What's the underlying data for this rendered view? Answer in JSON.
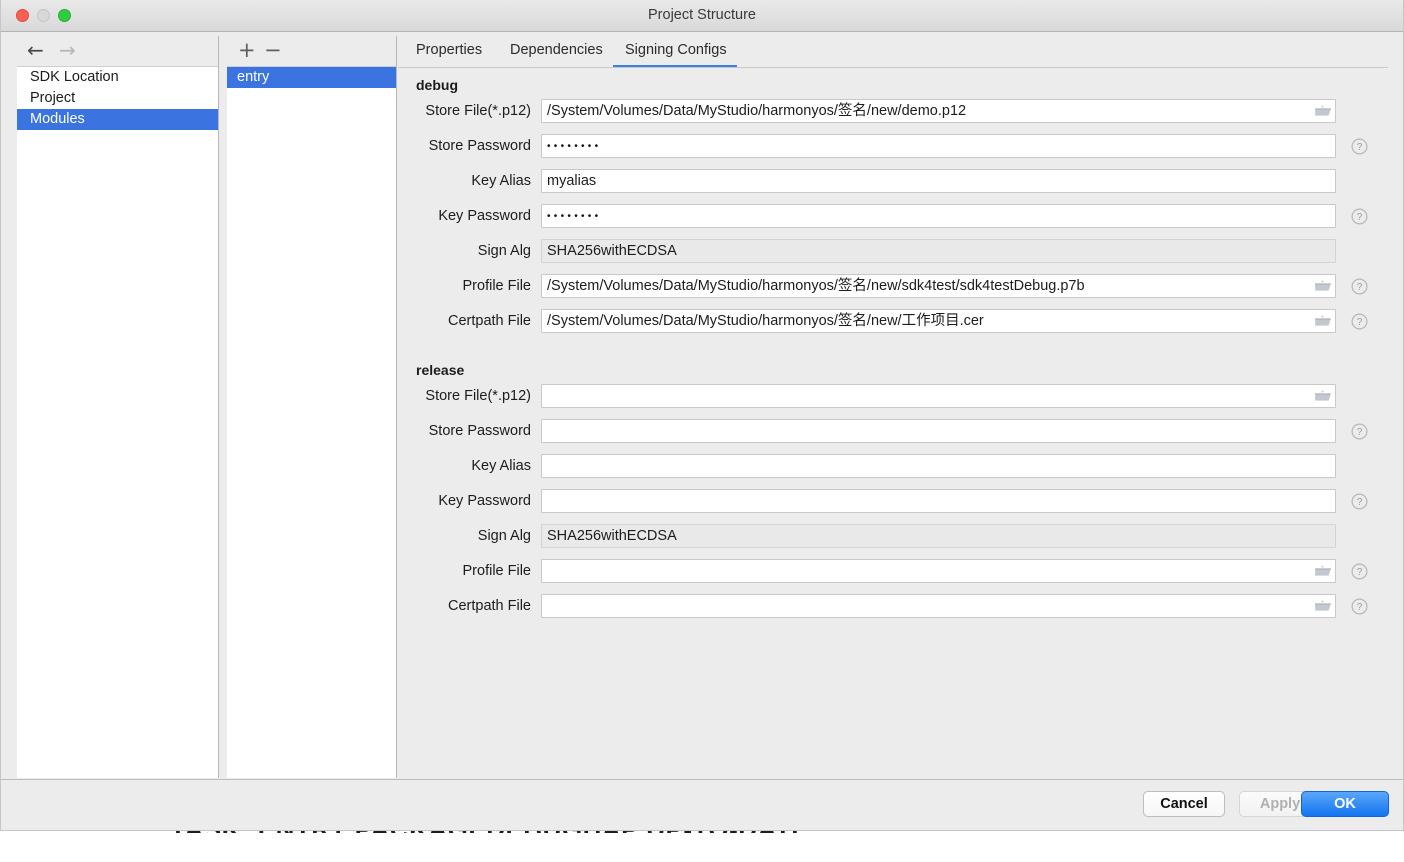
{
  "window": {
    "title": "Project Structure",
    "traffic_lights": [
      "close",
      "minimize",
      "maximize"
    ]
  },
  "sidebar": {
    "nav": {
      "back": "←",
      "forward": "→"
    },
    "items": [
      {
        "label": "SDK Location",
        "selected": false
      },
      {
        "label": "Project",
        "selected": false
      },
      {
        "label": "Modules",
        "selected": true
      }
    ]
  },
  "modules_panel": {
    "toolbar": {
      "add": "+",
      "remove": "−"
    },
    "items": [
      {
        "label": "entry",
        "selected": true
      }
    ]
  },
  "tabs": [
    {
      "label": "Properties",
      "active": false
    },
    {
      "label": "Dependencies",
      "active": false
    },
    {
      "label": "Signing Configs",
      "active": true
    }
  ],
  "accent_color": "#3c81e0",
  "selection_color": "#3b74e0",
  "groups": [
    {
      "title": "debug",
      "rows": [
        {
          "label": "Store File(*.p12)",
          "value": "/System/Volumes/Data/MyStudio/harmonyos/签名/new/demo.p12",
          "type": "text",
          "disabled": false,
          "folder": true,
          "help": false
        },
        {
          "label": "Store Password",
          "value": "••••••••",
          "type": "password",
          "disabled": false,
          "folder": false,
          "help": true
        },
        {
          "label": "Key Alias",
          "value": "myalias",
          "type": "text",
          "disabled": false,
          "folder": false,
          "help": false
        },
        {
          "label": "Key Password",
          "value": "••••••••",
          "type": "password",
          "disabled": false,
          "folder": false,
          "help": true
        },
        {
          "label": "Sign Alg",
          "value": "SHA256withECDSA",
          "type": "text",
          "disabled": true,
          "folder": false,
          "help": false
        },
        {
          "label": "Profile File",
          "value": "/System/Volumes/Data/MyStudio/harmonyos/签名/new/sdk4test/sdk4testDebug.p7b",
          "type": "text",
          "disabled": false,
          "folder": true,
          "help": true
        },
        {
          "label": "Certpath File",
          "value": "/System/Volumes/Data/MyStudio/harmonyos/签名/new/工作项目.cer",
          "type": "text",
          "disabled": false,
          "folder": true,
          "help": true
        }
      ]
    },
    {
      "title": "release",
      "rows": [
        {
          "label": "Store File(*.p12)",
          "value": "",
          "type": "text",
          "disabled": false,
          "folder": true,
          "help": false
        },
        {
          "label": "Store Password",
          "value": "",
          "type": "password",
          "disabled": false,
          "folder": false,
          "help": true
        },
        {
          "label": "Key Alias",
          "value": "",
          "type": "text",
          "disabled": false,
          "folder": false,
          "help": false
        },
        {
          "label": "Key Password",
          "value": "",
          "type": "password",
          "disabled": false,
          "folder": false,
          "help": true
        },
        {
          "label": "Sign Alg",
          "value": "SHA256withECDSA",
          "type": "text",
          "disabled": true,
          "folder": false,
          "help": false
        },
        {
          "label": "Profile File",
          "value": "",
          "type": "text",
          "disabled": false,
          "folder": true,
          "help": true
        },
        {
          "label": "Certpath File",
          "value": "",
          "type": "text",
          "disabled": false,
          "folder": true,
          "help": true
        }
      ]
    }
  ],
  "footer": {
    "cancel_label": "Cancel",
    "apply_label": "Apply",
    "apply_disabled": true,
    "ok_label": "OK"
  },
  "background_sliver": {
    "text": "TASK :ENTRY:PACKAGEDEBUGHAP UP-TO-DATE",
    "faint_text": "......"
  }
}
